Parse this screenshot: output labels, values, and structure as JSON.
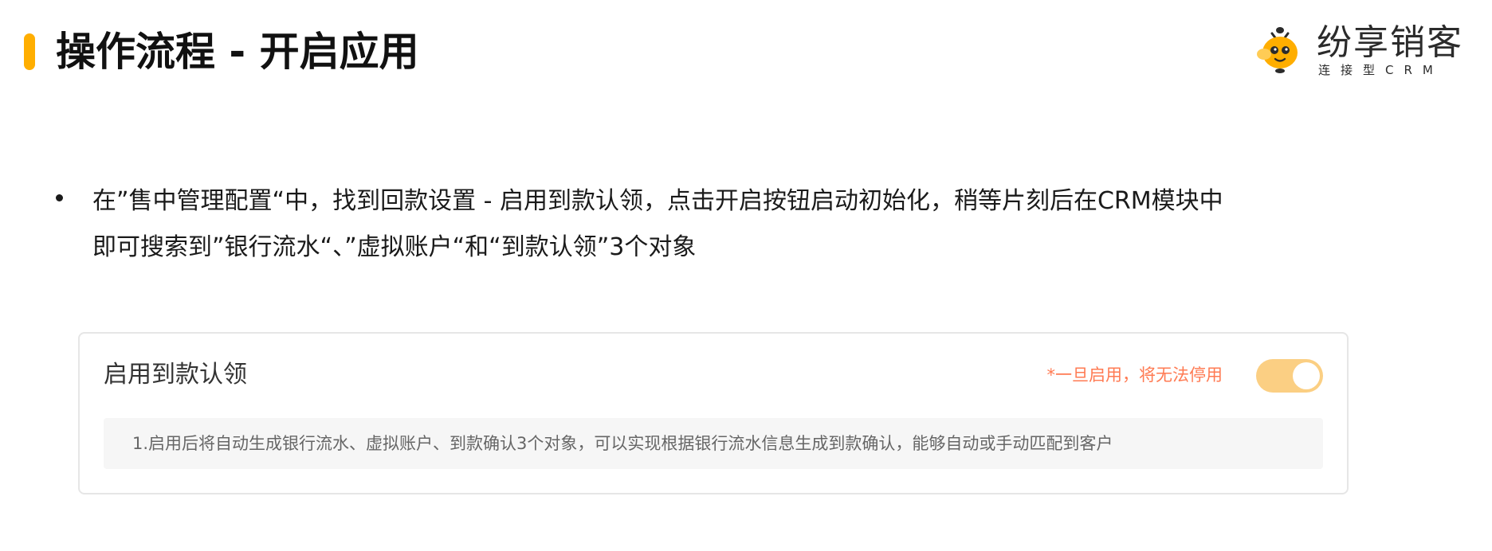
{
  "header": {
    "title": "操作流程 - 开启应用",
    "accent_color": "#FFAE00"
  },
  "logo": {
    "icon": "bee-mascot-icon",
    "name": "纷享销客",
    "tagline": "连接型CRM"
  },
  "content": {
    "bullet_lines": [
      "在”售中管理配置“中，找到回款设置 - 启用到款认领，点击开启按钮启动初始化，稍等片刻后在CRM模块中",
      "即可搜索到”银行流水“、”虚拟账户“和“到款认领”3个对象"
    ]
  },
  "card": {
    "title": "启用到款认领",
    "warning": "*一旦启用，将无法停用",
    "toggle_on": true,
    "toggle_color": "#FBCF83",
    "warning_color": "#FF7A52",
    "description": "1.启用后将自动生成银行流水、虚拟账户、到款确认3个对象，可以实现根据银行流水信息生成到款确认，能够自动或手动匹配到客户"
  }
}
